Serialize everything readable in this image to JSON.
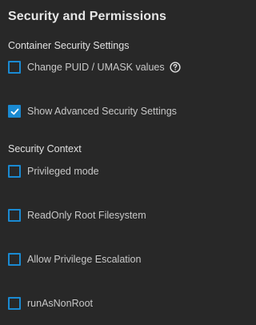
{
  "panel": {
    "title": "Security and Permissions"
  },
  "container_security": {
    "heading": "Container Security Settings",
    "items": [
      {
        "label": "Change PUID / UMASK values",
        "checked": false,
        "help_icon": "help-circle-icon"
      },
      {
        "label": "Show Advanced Security Settings",
        "checked": true
      }
    ]
  },
  "security_context": {
    "heading": "Security Context",
    "items": [
      {
        "label": "Privileged mode",
        "checked": false
      },
      {
        "label": "ReadOnly Root Filesystem",
        "checked": false
      },
      {
        "label": "Allow Privilege Escalation",
        "checked": false
      },
      {
        "label": "runAsNonRoot",
        "checked": false
      }
    ]
  },
  "colors": {
    "background": "#282828",
    "accent": "#1a8ad2",
    "text": "#c8c8c8"
  }
}
